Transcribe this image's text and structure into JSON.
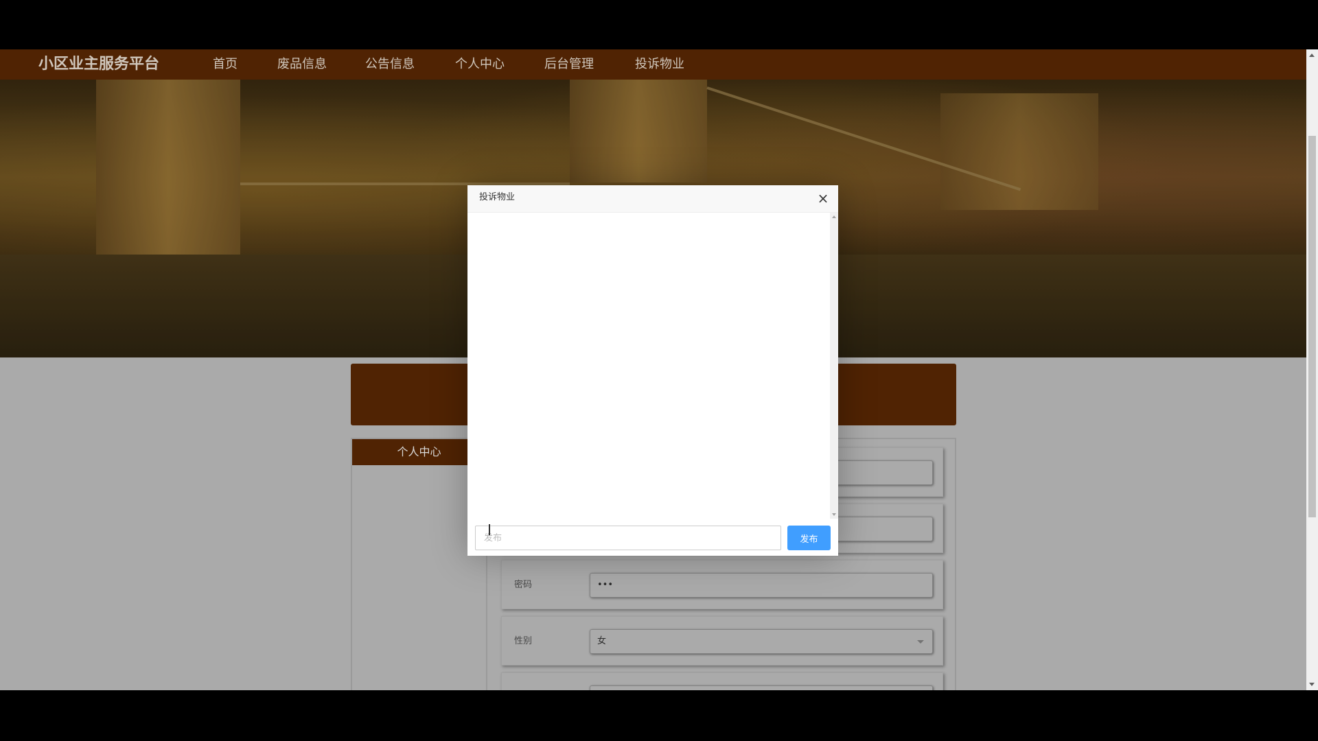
{
  "navbar": {
    "brand": "小区业主服务平台",
    "items": [
      {
        "label": "首页"
      },
      {
        "label": "废品信息"
      },
      {
        "label": "公告信息"
      },
      {
        "label": "个人中心"
      },
      {
        "label": "后台管理"
      },
      {
        "label": "投诉物业"
      }
    ]
  },
  "sidebar": {
    "title": "个人中心"
  },
  "form": {
    "password_label": "密码",
    "password_value": "•••",
    "gender_label": "性别",
    "gender_value": "女"
  },
  "modal": {
    "title": "投诉物业",
    "close_glyph": "×",
    "input_placeholder": "发布",
    "post_label": "发布"
  },
  "colors": {
    "brand": "#5e2a04",
    "primary_button": "#409eff"
  }
}
